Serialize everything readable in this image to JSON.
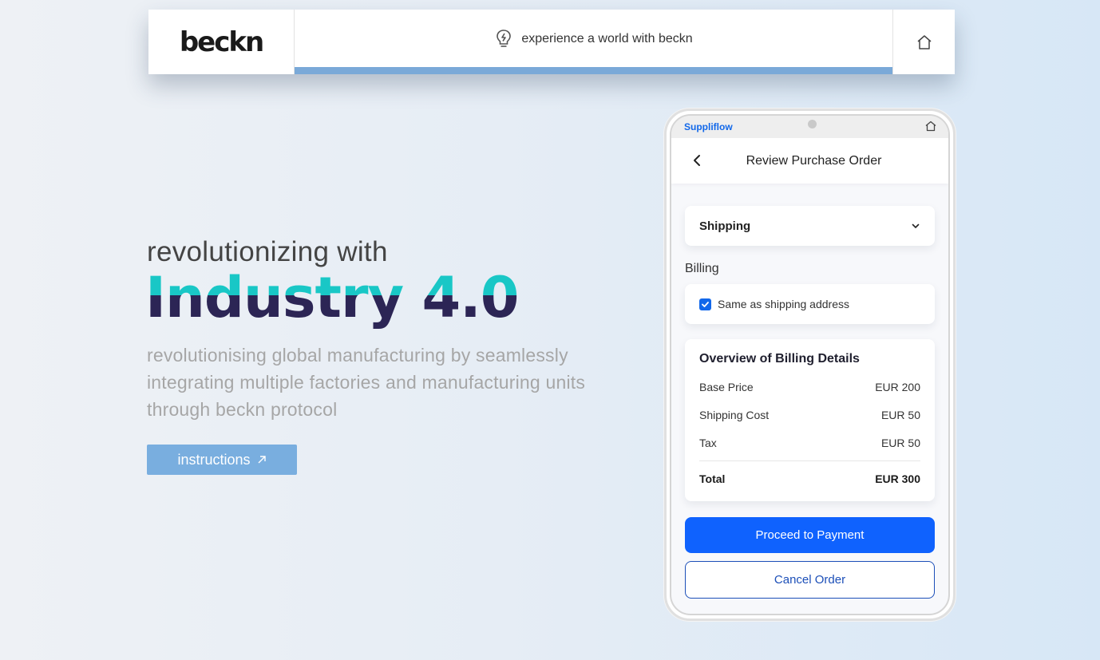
{
  "header": {
    "logo": "beckn",
    "tagline": "experience a world with beckn",
    "accent_color": "#7aa9d8",
    "icons": {
      "tagline": "lightbulb-icon",
      "home": "home-icon"
    }
  },
  "hero": {
    "subtitle": "revolutionizing with",
    "title": "Industry 4.0",
    "description": "revolutionising global manufacturing by seamlessly integrating multiple factories and manufacturing units through beckn protocol",
    "instructions_label": "instructions",
    "title_colors": {
      "top": "#19c7c6",
      "bottom": "#2c2555"
    },
    "button_color": "#79aedf"
  },
  "phone": {
    "brand": "Suppliflow",
    "nav_title": "Review Purchase Order",
    "shipping": {
      "label": "Shipping"
    },
    "billing": {
      "label": "Billing",
      "same_as_shipping_label": "Same as shipping address",
      "same_as_shipping_checked": true
    },
    "overview": {
      "title": "Overview of Billing Details",
      "rows": [
        {
          "label": "Base Price",
          "value": "EUR 200"
        },
        {
          "label": "Shipping Cost",
          "value": "EUR 50"
        },
        {
          "label": "Tax",
          "value": "EUR 50"
        }
      ],
      "total": {
        "label": "Total",
        "value": "EUR 300"
      }
    },
    "proceed_label": "Proceed to Payment",
    "cancel_label": "Cancel Order",
    "primary_color": "#0f62fe"
  }
}
